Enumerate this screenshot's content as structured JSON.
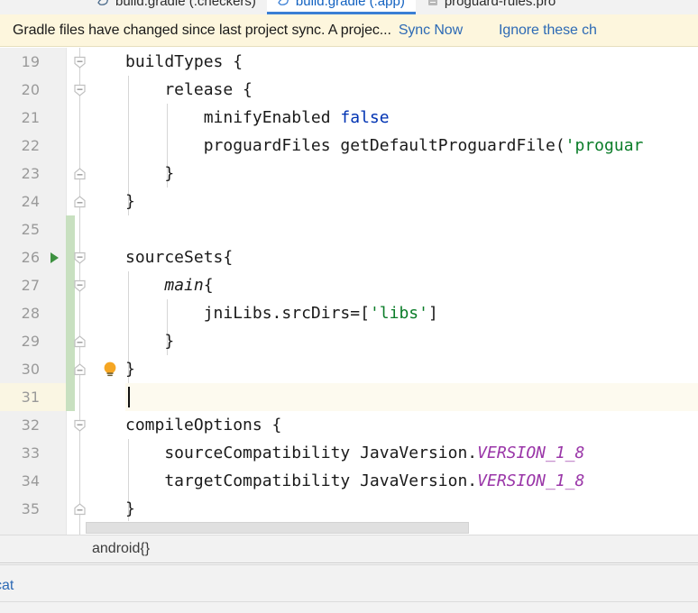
{
  "editor_tabs": [
    {
      "label": "build.gradle (:checkers)",
      "icon": "gradle-file-icon",
      "active": false
    },
    {
      "label": "build.gradle (:app)",
      "icon": "gradle-file-icon",
      "active": true
    },
    {
      "label": "proguard-rules.pro",
      "icon": "text-file-icon",
      "active": false
    }
  ],
  "banner": {
    "message": "Gradle files have changed since last project sync. A projec...",
    "sync_label": "Sync Now",
    "ignore_label": "Ignore these ch"
  },
  "code_lines": [
    {
      "number": "19",
      "indent_guides": 0,
      "fold": "open",
      "text": "buildTypes {"
    },
    {
      "number": "20",
      "indent_guides": 1,
      "fold": "open",
      "text": "    release {"
    },
    {
      "number": "21",
      "indent_guides": 2,
      "fold": "none",
      "text": "        minifyEnabled false"
    },
    {
      "number": "22",
      "indent_guides": 2,
      "fold": "none",
      "text": "        proguardFiles getDefaultProguardFile('proguar"
    },
    {
      "number": "23",
      "indent_guides": 2,
      "fold": "close",
      "text": "    }"
    },
    {
      "number": "24",
      "indent_guides": 1,
      "fold": "close",
      "text": "}"
    },
    {
      "number": "25",
      "indent_guides": 0,
      "fold": "none",
      "text": ""
    },
    {
      "number": "26",
      "indent_guides": 0,
      "fold": "open",
      "text": "sourceSets{"
    },
    {
      "number": "27",
      "indent_guides": 1,
      "fold": "open",
      "text": "    main{"
    },
    {
      "number": "28",
      "indent_guides": 2,
      "fold": "none",
      "text": "        jniLibs.srcDirs=['libs']"
    },
    {
      "number": "29",
      "indent_guides": 2,
      "fold": "close",
      "text": "    }"
    },
    {
      "number": "30",
      "indent_guides": 1,
      "fold": "close",
      "text": "}"
    },
    {
      "number": "31",
      "indent_guides": 0,
      "fold": "none",
      "text": ""
    },
    {
      "number": "32",
      "indent_guides": 0,
      "fold": "open",
      "text": "compileOptions {"
    },
    {
      "number": "33",
      "indent_guides": 1,
      "fold": "none",
      "text": "    sourceCompatibility JavaVersion.VERSION_1_8"
    },
    {
      "number": "34",
      "indent_guides": 1,
      "fold": "none",
      "text": "    targetCompatibility JavaVersion.VERSION_1_8"
    },
    {
      "number": "35",
      "indent_guides": 1,
      "fold": "close",
      "text": "}"
    }
  ],
  "gutter": {
    "run_marker_line": "26",
    "bulb_line": "30",
    "caret_line": "31",
    "vcs_change_from_line": "25",
    "vcs_change_to_line": "31"
  },
  "breadcrumb": {
    "path": "android{}"
  },
  "tool_window": {
    "logcat_label": "cat"
  },
  "colors": {
    "banner_bg": "#fdf6dd",
    "link": "#2d6ab5",
    "keyword": "#0033b3",
    "string": "#0a7c28",
    "static_field": "#9a36a8",
    "vcs_changed": "#c8e0c0",
    "caret_row": "#fdfaef",
    "active_tab_underline": "#3a7fd5",
    "run_marker": "#3d9140",
    "bulb": "#f5a623"
  }
}
